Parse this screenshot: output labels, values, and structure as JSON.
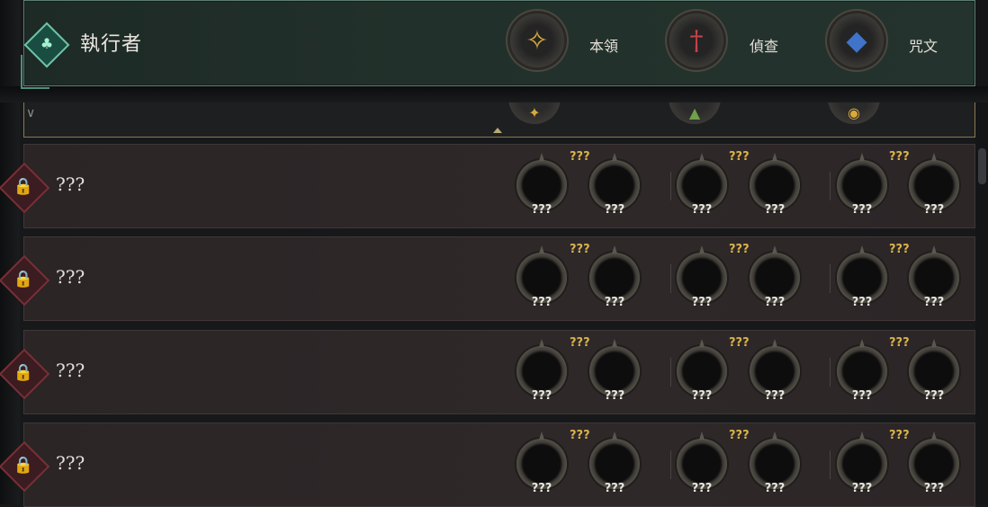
{
  "header": {
    "class_name": "執行者",
    "class_icon": "leaf-emblem-icon",
    "stats": [
      {
        "label": "本領",
        "icon": "winged-boot-icon",
        "color": "#d9a93c"
      },
      {
        "label": "偵查",
        "icon": "dagger-icon",
        "color": "#c8424a"
      },
      {
        "label": "咒文",
        "icon": "blue-crest-icon",
        "color": "#3f74c9"
      }
    ]
  },
  "rows": [
    {
      "name": "???",
      "locked": true,
      "groups": [
        {
          "label": "???",
          "slots": [
            "???",
            "???"
          ]
        },
        {
          "label": "???",
          "slots": [
            "???",
            "???"
          ]
        },
        {
          "label": "???",
          "slots": [
            "???",
            "???"
          ]
        }
      ]
    },
    {
      "name": "???",
      "locked": true,
      "groups": [
        {
          "label": "???",
          "slots": [
            "???",
            "???"
          ]
        },
        {
          "label": "???",
          "slots": [
            "???",
            "???"
          ]
        },
        {
          "label": "???",
          "slots": [
            "???",
            "???"
          ]
        }
      ]
    },
    {
      "name": "???",
      "locked": true,
      "groups": [
        {
          "label": "???",
          "slots": [
            "???",
            "???"
          ]
        },
        {
          "label": "???",
          "slots": [
            "???",
            "???"
          ]
        },
        {
          "label": "???",
          "slots": [
            "???",
            "???"
          ]
        }
      ]
    },
    {
      "name": "???",
      "locked": true,
      "groups": [
        {
          "label": "???",
          "slots": [
            "???",
            "???"
          ]
        },
        {
          "label": "???",
          "slots": [
            "???",
            "???"
          ]
        },
        {
          "label": "???",
          "slots": [
            "???",
            "???"
          ]
        }
      ]
    }
  ],
  "colors": {
    "accent_teal": "#6fc3a6",
    "locked_red": "#7a2f36",
    "gold_label": "#d9b34a"
  }
}
